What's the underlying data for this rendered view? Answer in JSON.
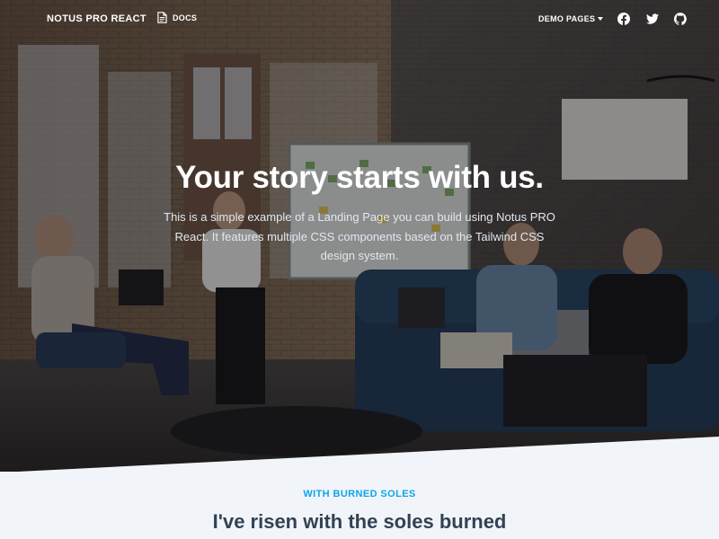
{
  "navbar": {
    "brand": "NOTUS PRO REACT",
    "docs_label": "DOCS",
    "demo_pages_label": "DEMO PAGES",
    "social": [
      {
        "icon": "facebook-icon"
      },
      {
        "icon": "twitter-icon"
      },
      {
        "icon": "github-icon"
      }
    ]
  },
  "hero": {
    "title": "Your story starts with us.",
    "subtitle": "This is a simple example of a Landing Page you can build using Notus PRO React. It features multiple CSS components based on the Tailwind CSS design system."
  },
  "section": {
    "label": "WITH BURNED SOLES",
    "title": "I've risen with the soles burned"
  },
  "colors": {
    "accent": "#0ea5e9",
    "heading": "#334155",
    "section_bg": "#f1f5f9"
  }
}
